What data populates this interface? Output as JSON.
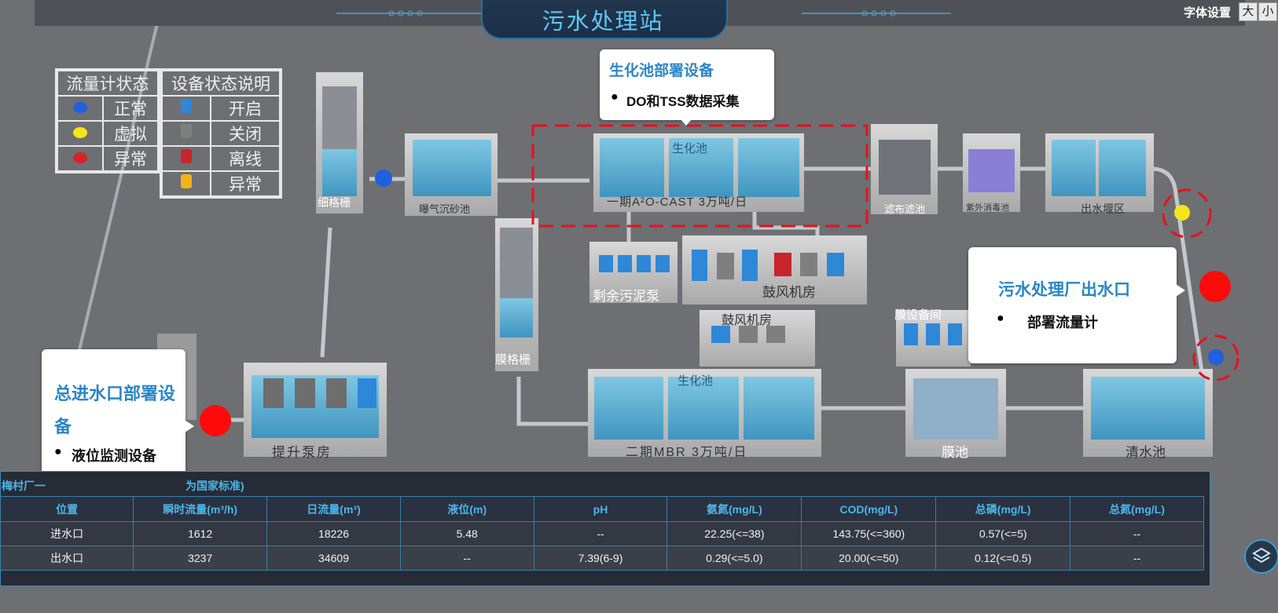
{
  "header": {
    "title": "污水处理站",
    "font_settings_label": "字体设置",
    "font_large": "大",
    "font_small": "小"
  },
  "legend_flow": {
    "title": "流量计状态",
    "items": [
      {
        "label": "正常",
        "color": "#1f5fe0"
      },
      {
        "label": "虚拟",
        "color": "#f3e51a"
      },
      {
        "label": "异常",
        "color": "#d62424"
      }
    ]
  },
  "legend_device": {
    "title": "设备状态说明",
    "items": [
      {
        "label": "开启",
        "color": "#2f87d8"
      },
      {
        "label": "关闭",
        "color": "#7f7f7f"
      },
      {
        "label": "离线",
        "color": "#c8242b"
      },
      {
        "label": "异常",
        "color": "#f0b419"
      }
    ]
  },
  "facilities": {
    "fine_screen": "细格栅",
    "aerated_grit": "曝气沉砂池",
    "bio_tank": "生化池",
    "phase1": "一期A²O-CAST 3万吨/日",
    "cloth_filter": "滤布滤池",
    "uv": "紫外消毒池",
    "outfall_weir": "出水堰区",
    "sludge_pump": "剩余污泥泵",
    "blower_room": "鼓风机房",
    "membrane_screen": "膜格栅",
    "membrane_equipment": "膜设备间",
    "lift_pump": "提升泵房",
    "phase2": "二期MBR 3万吨/日",
    "membrane_tank": "膜池",
    "clear_tank": "清水池"
  },
  "callouts": {
    "bio": {
      "title": "生化池部署设备",
      "item": "DO和TSS数据采集"
    },
    "outlet": {
      "title": "污水处理厂出水口",
      "item": "部署流量计"
    },
    "inlet": {
      "title": "总进水口部署设备",
      "item": "液位监测设备"
    }
  },
  "table": {
    "caption_left": "梅村厂一",
    "caption_right": "为国家标准)",
    "headers": [
      "位置",
      "瞬时流量(m³/h)",
      "日流量(m³)",
      "液位(m)",
      "pH",
      "氨氮(mg/L)",
      "COD(mg/L)",
      "总磷(mg/L)",
      "总氮(mg/L)"
    ],
    "rows": [
      [
        "进水口",
        "1612",
        "18226",
        "5.48",
        "--",
        "22.25(<=38)",
        "143.75(<=360)",
        "0.57(<=5)",
        "--"
      ],
      [
        "出水口",
        "3237",
        "34609",
        "--",
        "7.39(6-9)",
        "0.29(<=5.0)",
        "20.00(<=50)",
        "0.12(<=0.5)",
        "--"
      ]
    ]
  },
  "colors": {
    "accent": "#4db8ee",
    "marker_red": "#ff0a0a",
    "highlight_dash": "#e8101a",
    "callout_title": "#2b86c5"
  },
  "icons": {
    "layers": "layers-icon"
  }
}
